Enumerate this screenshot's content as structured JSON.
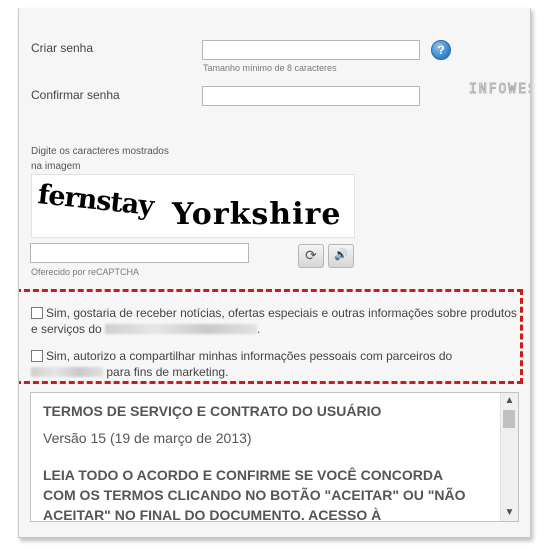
{
  "form": {
    "password_label": "Criar senha",
    "password_hint": "Tamanho mínimo de 8 caracteres",
    "help_symbol": "?",
    "confirm_label": "Confirmar senha"
  },
  "watermark": "INFOWESTER",
  "captcha": {
    "instruction_line1": "Digite os caracteres mostrados",
    "instruction_line2": "na imagem",
    "word1": "fernstay",
    "word2": "Yorkshire",
    "provider": "Oferecido por reCAPTCHA",
    "refresh_symbol": "⟳",
    "audio_symbol": "🔊"
  },
  "options": {
    "marketing_part1": "Sim, gostaria de receber notícias, ofertas especiais e outras informações sobre produtos e serviços do",
    "marketing_part2": ".",
    "sharing_part1": "Sim, autorizo a compartilhar minhas informações pessoais com parceiros do",
    "sharing_part2": "para fins de marketing."
  },
  "terms": {
    "title": "TERMOS DE SERVIÇO E CONTRATO DO USUÁRIO",
    "version": "Versão 15 (19 de março de 2013)",
    "body": "LEIA TODO O ACORDO E CONFIRME SE VOCÊ CONCORDA COM OS TERMOS CLICANDO NO BOTÃO \"ACEITAR\" OU \"NÃO ACEITAR\" NO FINAL DO DOCUMENTO. ACESSO À",
    "scroll_up": "▲",
    "scroll_down": "▼"
  }
}
